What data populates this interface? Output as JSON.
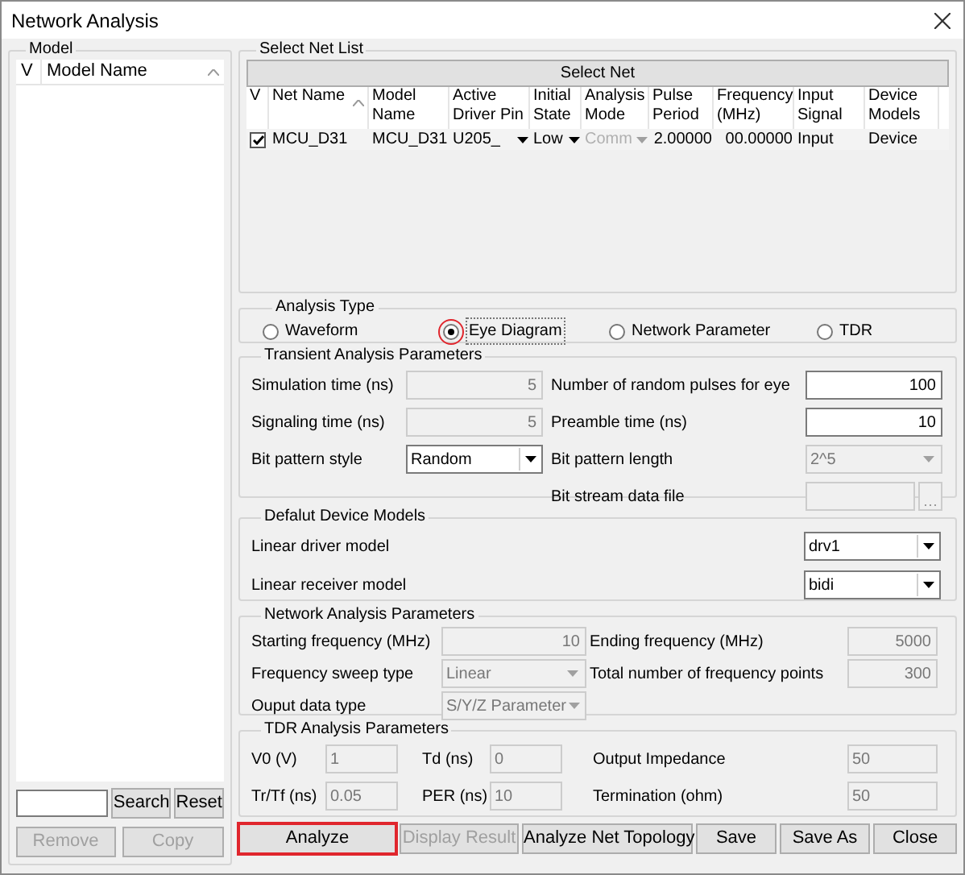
{
  "window": {
    "title": "Network Analysis"
  },
  "model_panel": {
    "title": "Model",
    "columns": [
      "V",
      "Model Name"
    ],
    "buttons": [
      {
        "label": "Search",
        "disabled": false
      },
      {
        "label": "Reset",
        "disabled": false
      },
      {
        "label": "Remove",
        "disabled": true
      },
      {
        "label": "Copy",
        "disabled": true
      }
    ]
  },
  "net_list": {
    "title": "Select Net List",
    "select_button": "Select Net",
    "columns": [
      "V",
      "Net Name",
      "Model Name",
      "Active Driver Pin",
      "Initial State",
      "Analysis Mode",
      "Pulse Period",
      "Frequency (MHz)",
      "Input Signal",
      "Device Models"
    ],
    "rows": [
      {
        "cells": [
          {
            "kind": "checkbox",
            "checked": true
          },
          {
            "kind": "text",
            "value": "MCU_D31",
            "disabled": false
          },
          {
            "kind": "text",
            "value": "MCU_D31",
            "disabled": false
          },
          {
            "kind": "select",
            "value": "U205_",
            "disabled": false
          },
          {
            "kind": "select",
            "value": "Low",
            "disabled": false
          },
          {
            "kind": "select",
            "value": "Comm",
            "disabled": true
          },
          {
            "kind": "number",
            "value": "2.00000",
            "disabled": false
          },
          {
            "kind": "number",
            "value": "00.00000",
            "disabled": false
          },
          {
            "kind": "text",
            "value": "Input",
            "disabled": false
          },
          {
            "kind": "text",
            "value": "Device",
            "disabled": false
          }
        ]
      }
    ]
  },
  "analysis_type": {
    "title": "Analysis Type",
    "options": [
      {
        "label": "Waveform",
        "selected": false,
        "highlighted": false
      },
      {
        "label": "Eye Diagram",
        "selected": true,
        "highlighted": true
      },
      {
        "label": "Network Parameter",
        "selected": false,
        "highlighted": false
      },
      {
        "label": "TDR",
        "selected": false,
        "highlighted": false
      }
    ]
  },
  "transient_parameters": {
    "title": "Transient Analysis Parameters",
    "fields": [
      {
        "label": "Simulation time (ns)",
        "kind": "number",
        "value": "5",
        "disabled": true
      },
      {
        "label": "Number of random pulses for eye",
        "kind": "number",
        "value": "100",
        "disabled": false
      },
      {
        "label": "Signaling time (ns)",
        "kind": "number",
        "value": "5",
        "disabled": true
      },
      {
        "label": "Preamble time (ns)",
        "kind": "number",
        "value": "10",
        "disabled": false
      },
      {
        "label": "Bit pattern style",
        "kind": "select",
        "value": "Random",
        "disabled": false
      },
      {
        "label": "Bit pattern length",
        "kind": "select",
        "value": "2^5",
        "disabled": true
      },
      {
        "label": "Bit stream data file",
        "kind": "file",
        "disabled": true
      }
    ]
  },
  "device_models": {
    "title": "Defalut Device Models",
    "fields": [
      {
        "label": "Linear driver model",
        "kind": "select",
        "value": "drv1",
        "disabled": false
      },
      {
        "label": "Linear receiver model",
        "kind": "select",
        "value": "bidi",
        "disabled": false
      }
    ]
  },
  "network_parameters": {
    "title": "Network Analysis Parameters",
    "fields": [
      {
        "label": "Starting frequency (MHz)",
        "kind": "number",
        "value": "10",
        "disabled": true
      },
      {
        "label": "Ending frequency (MHz)",
        "kind": "number",
        "value": "5000",
        "disabled": true
      },
      {
        "label": "Frequency sweep type",
        "kind": "select",
        "value": "Linear",
        "disabled": true
      },
      {
        "label": "Total number of frequency points",
        "kind": "number",
        "value": "300",
        "disabled": true
      },
      {
        "label": "Ouput data type",
        "kind": "select",
        "value": "S/Y/Z Parameter",
        "disabled": true
      }
    ]
  },
  "tdr_parameters": {
    "title": "TDR Analysis Parameters",
    "fields": [
      {
        "label": "V0 (V)",
        "kind": "text",
        "value": "1",
        "disabled": true
      },
      {
        "label": "Td (ns)",
        "kind": "text",
        "value": "0",
        "disabled": true
      },
      {
        "label": "Output Impedance",
        "kind": "text",
        "value": "50",
        "disabled": true
      },
      {
        "label": "Tr/Tf (ns)",
        "kind": "text",
        "value": "0.05",
        "disabled": true
      },
      {
        "label": "PER (ns)",
        "kind": "text",
        "value": "10",
        "disabled": true
      },
      {
        "label": "Termination (ohm)",
        "kind": "text",
        "value": "50",
        "disabled": true
      }
    ]
  },
  "buttons": [
    {
      "label": "Analyze",
      "disabled": false,
      "highlighted": true
    },
    {
      "label": "Display Result",
      "disabled": true,
      "highlighted": false
    },
    {
      "label": "Analyze Net Topology",
      "disabled": false,
      "highlighted": false
    },
    {
      "label": "Save",
      "disabled": false,
      "highlighted": false
    },
    {
      "label": "Save As",
      "disabled": false,
      "highlighted": false
    },
    {
      "label": "Close",
      "disabled": false,
      "highlighted": false
    }
  ]
}
